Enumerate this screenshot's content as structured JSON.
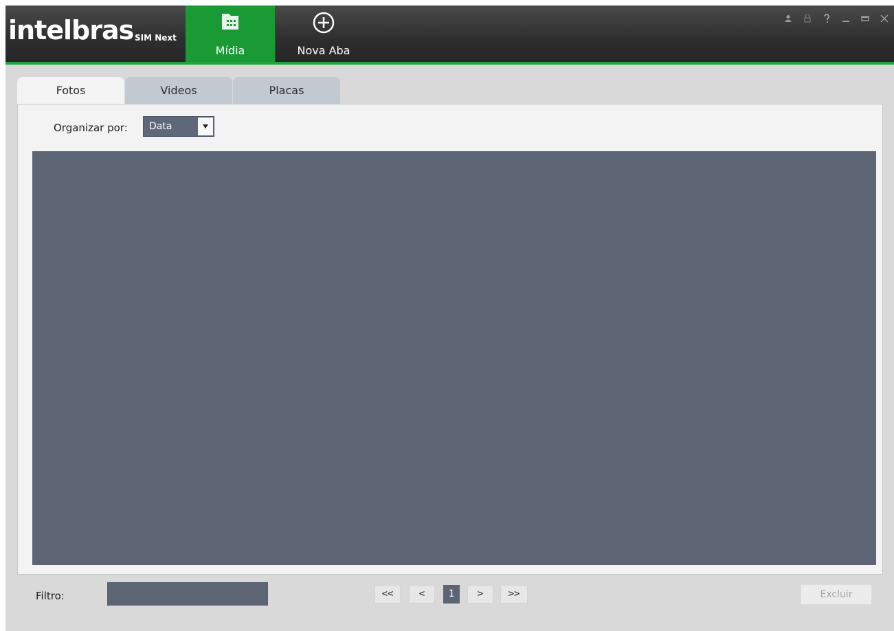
{
  "app": {
    "brand": "intelbras",
    "product": "SIM Next"
  },
  "main_tabs": [
    {
      "label": "Mídia",
      "icon": "media-folder-icon",
      "active": true
    },
    {
      "label": "Nova Aba",
      "icon": "plus-circle-icon",
      "active": false
    }
  ],
  "window_controls": [
    "user-icon",
    "lock-icon",
    "help-icon",
    "minimize-icon",
    "maximize-icon",
    "close-icon"
  ],
  "sub_tabs": [
    {
      "label": "Fotos",
      "active": true
    },
    {
      "label": "Videos",
      "active": false
    },
    {
      "label": "Placas",
      "active": false
    }
  ],
  "organize": {
    "label": "Organizar por:",
    "selected": "Data"
  },
  "filter": {
    "label": "Filtro:",
    "value": ""
  },
  "pagination": {
    "first": "<<",
    "prev": "<",
    "current": "1",
    "next": ">",
    "last": ">>"
  },
  "actions": {
    "delete_label": "Excluir"
  },
  "colors": {
    "accent_green": "#1a9a35",
    "titlebar_dark": "#2e2e2e",
    "media_area": "#5d6575"
  }
}
